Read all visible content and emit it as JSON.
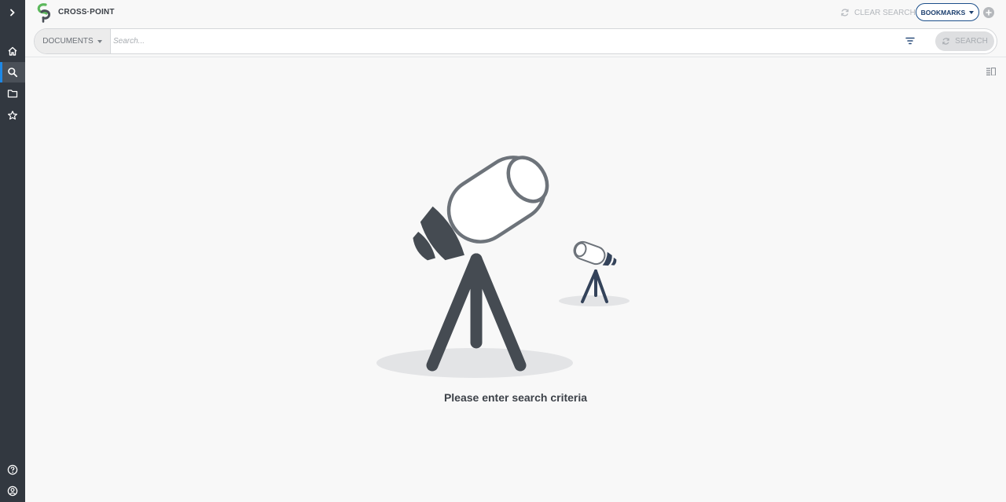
{
  "app": {
    "title": "CROSS·POINT"
  },
  "header": {
    "clear_search_label": "CLEAR SEARCH",
    "bookmarks_label": "BOOKMARKS"
  },
  "search": {
    "category": "DOCUMENTS",
    "placeholder": "Search...",
    "value": "",
    "button_label": "SEARCH"
  },
  "main": {
    "empty_message": "Please enter search criteria"
  },
  "sidebar": {
    "items": [
      {
        "icon": "chevron-right-icon"
      },
      {
        "icon": "home-icon"
      },
      {
        "icon": "search-icon",
        "active": true
      },
      {
        "icon": "folder-icon"
      },
      {
        "icon": "star-icon"
      },
      {
        "icon": "help-icon"
      },
      {
        "icon": "account-icon"
      }
    ]
  },
  "colors": {
    "sidebar": "#323840",
    "accent": "#1e88e5",
    "bookmarks_border": "#1c4f8a",
    "logo_green": "#5cb85c",
    "illustration_dark": "#454b52"
  }
}
